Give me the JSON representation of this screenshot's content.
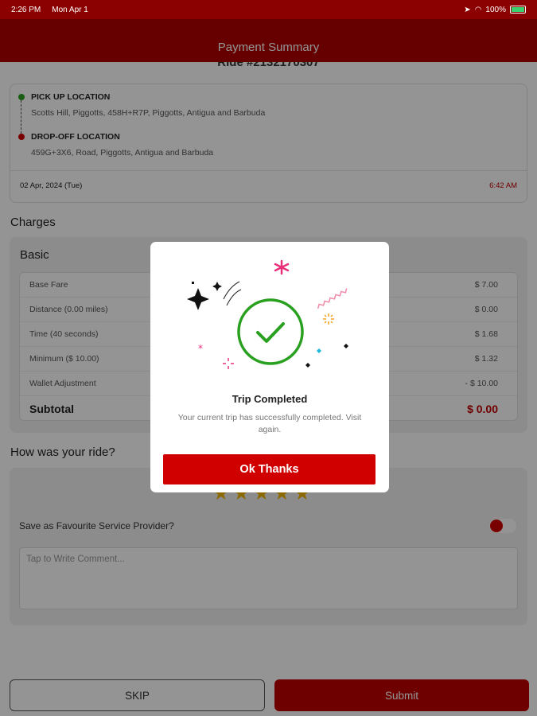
{
  "status_bar": {
    "time": "2:26 PM",
    "date": "Mon Apr 1",
    "battery": "100%"
  },
  "header": {
    "title": "Payment Summary"
  },
  "ride": {
    "id_label": "Ride #2132170307",
    "pickup_title": "PICK UP LOCATION",
    "pickup_address": "Scotts Hill, Piggotts, 458H+R7P, Piggotts, Antigua and Barbuda",
    "dropoff_title": "DROP-OFF LOCATION",
    "dropoff_address": "459G+3X6, Road, Piggotts, Antigua and Barbuda",
    "date": "02 Apr, 2024 (Tue)",
    "time": "6:42 AM"
  },
  "charges": {
    "section_title": "Charges",
    "group_title": "Basic",
    "items": [
      {
        "label": "Base Fare",
        "value": "$ 7.00"
      },
      {
        "label": "Distance (0.00 miles)",
        "value": "$ 0.00"
      },
      {
        "label": "Time (40 seconds)",
        "value": "$ 1.68"
      },
      {
        "label": "Minimum ($ 10.00)",
        "value": "$ 1.32"
      },
      {
        "label": "Wallet Adjustment",
        "value": "- $ 10.00"
      }
    ],
    "subtotal_label": "Subtotal",
    "subtotal_value": "$ 0.00"
  },
  "rating": {
    "section_title": "How was your ride?",
    "stars": "★★★★★",
    "favourite_label": "Save as Favourite Service Provider?",
    "comment_placeholder": "Tap to Write Comment..."
  },
  "footer": {
    "skip_label": "SKIP",
    "submit_label": "Submit"
  },
  "modal": {
    "title": "Trip Completed",
    "message": "Your current trip has successfully completed. Visit again.",
    "button_label": "Ok Thanks"
  },
  "colors": {
    "brand": "#b00000",
    "accent": "#d00000",
    "success": "#2aa020",
    "star": "#f1b300"
  }
}
